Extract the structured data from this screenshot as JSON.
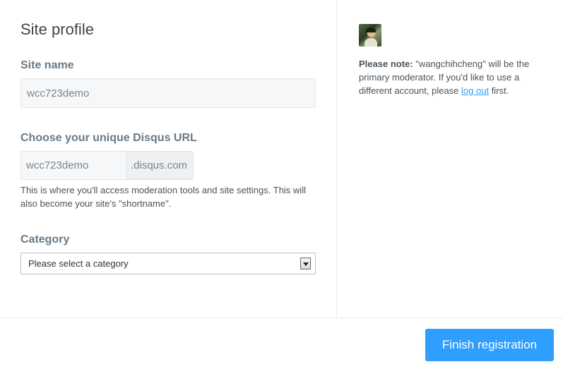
{
  "title": "Site profile",
  "site_name": {
    "label": "Site name",
    "value": "wcc723demo"
  },
  "url": {
    "label": "Choose your unique Disqus URL",
    "value": "wcc723demo",
    "suffix": ".disqus.com",
    "help": "This is where you'll access moderation tools and site settings. This will also become your site's \"shortname\"."
  },
  "category": {
    "label": "Category",
    "selected": "Please select a category"
  },
  "sidebar": {
    "avatar_icon": "user-avatar",
    "note_bold": "Please note:",
    "note_text": " \"wangchihcheng\" will be the primary moderator. If you'd like to use a different account, please ",
    "logout_link": "log out",
    "note_end": " first."
  },
  "footer": {
    "finish_label": "Finish registration"
  },
  "colors": {
    "accent": "#2e9fff",
    "label": "#687a86",
    "border": "#e6e9ec"
  }
}
